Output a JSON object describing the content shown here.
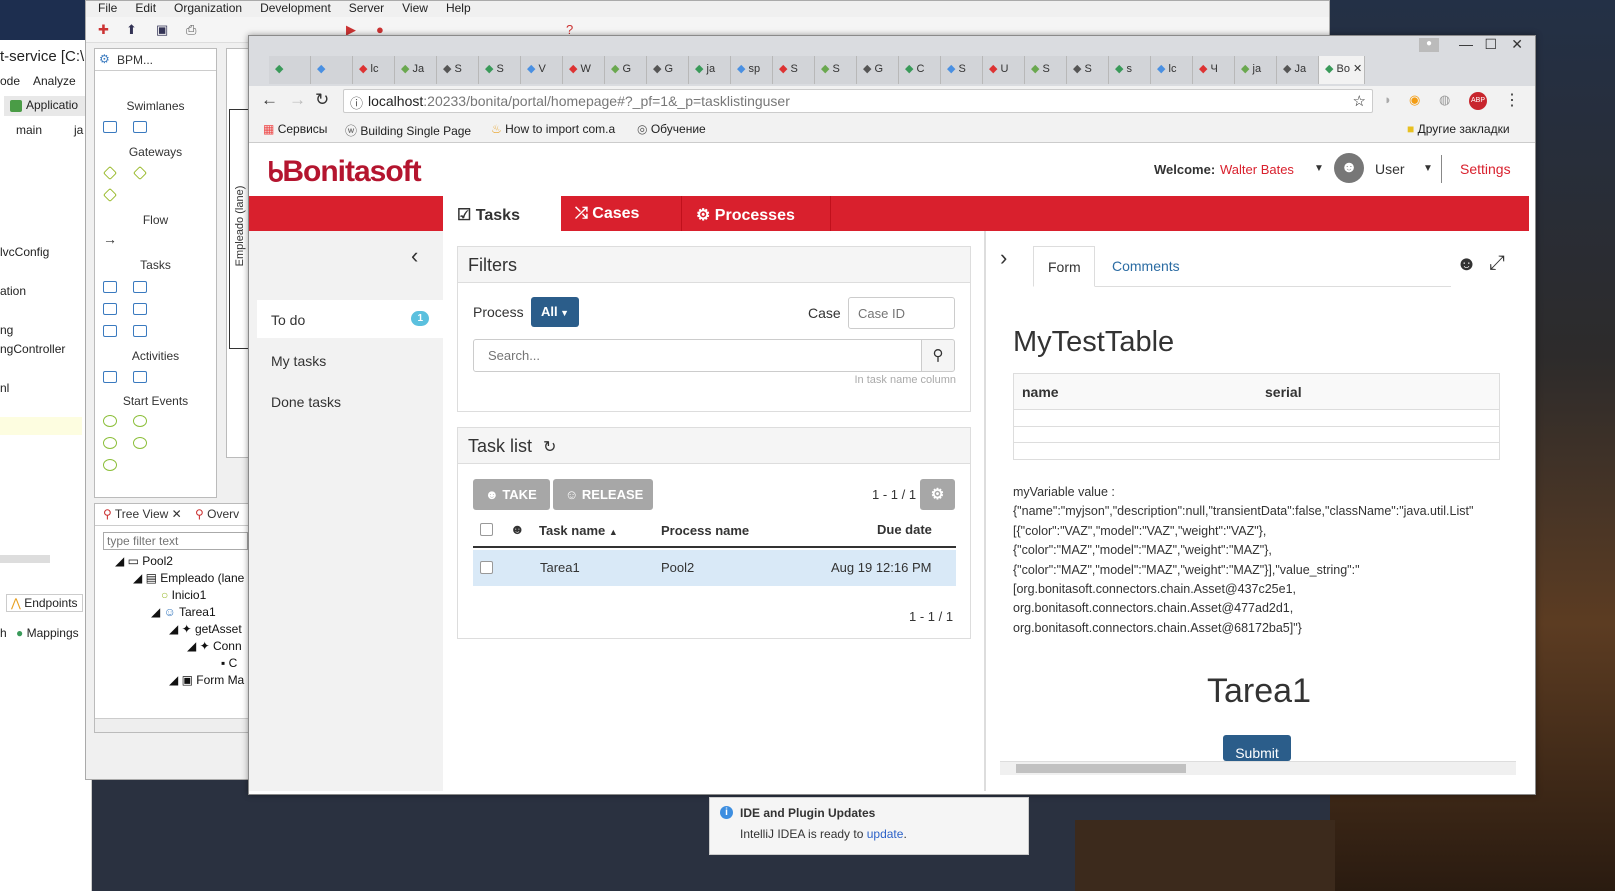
{
  "ide_left": {
    "title": "t-service [C:\\P",
    "menu": [
      "ode",
      "Analyze"
    ],
    "toolbar_label": "Applicatio",
    "crumbs": [
      "main",
      "ja"
    ],
    "items": [
      "lvcConfig",
      "ation",
      "ng",
      "ngController",
      "nl"
    ],
    "bottom_tabs": [
      "Endpoints",
      "Mappings"
    ],
    "bottom_prefix": "h"
  },
  "eclipse": {
    "menu": [
      "File",
      "Edit",
      "Organization",
      "Development",
      "Server",
      "View",
      "Help"
    ],
    "palette_tab": "BPM...",
    "palette_sections": [
      "Swimlanes",
      "Gateways",
      "Flow",
      "Tasks",
      "Activities",
      "Start Events"
    ],
    "lane_label": "Empleado (lane)",
    "tree_tabs": [
      "Tree View",
      "Overv"
    ],
    "tree_filter_placeholder": "type filter text",
    "tree_nodes": [
      "Pool2",
      "Empleado (lane",
      "Inicio1",
      "Tarea1",
      "getAsset",
      "Conn",
      "C",
      "Form Ma"
    ]
  },
  "chrome": {
    "tabs": [
      "",
      "",
      "lc",
      "Ja",
      "S",
      "S",
      "V",
      "W",
      "G",
      "G",
      "ja",
      "sp",
      "S",
      "S",
      "G",
      "C",
      "S",
      "U",
      "S",
      "S",
      "s",
      "lc",
      "Ч",
      "ja",
      "Ja",
      "Bo"
    ],
    "active_tab_label": "Bo",
    "url_host": "localhost",
    "url_rest": ":20233/bonita/portal/homepage#?_pf=1&_p=tasklistinguser",
    "bookmarks": [
      "Сервисы",
      "Building Single Page",
      "How to import com.a",
      "Обучение"
    ],
    "other_bookmarks": "Другие закладки"
  },
  "bonita": {
    "logo": "Bonitasoft",
    "welcome_label": "Welcome:",
    "user_name": "Walter Bates",
    "profile": "User",
    "settings": "Settings",
    "nav": [
      "Tasks",
      "Cases",
      "Processes"
    ],
    "sidebar": [
      {
        "label": "To do",
        "badge": "1"
      },
      {
        "label": "My tasks"
      },
      {
        "label": "Done tasks"
      }
    ],
    "filters": {
      "title": "Filters",
      "process_label": "Process",
      "process_value": "All",
      "case_label": "Case",
      "case_placeholder": "Case ID",
      "search_placeholder": "Search...",
      "search_hint": "In task name column"
    },
    "tasklist": {
      "title": "Task list",
      "take": "TAKE",
      "release": "RELEASE",
      "pager_top": "1 - 1 / 1",
      "pager_bottom": "1 - 1 / 1",
      "columns": [
        "Task name",
        "Process name",
        "Due date"
      ],
      "rows": [
        {
          "task": "Tarea1",
          "process": "Pool2",
          "due": "Aug 19 12:16 PM"
        }
      ]
    },
    "form": {
      "tabs": [
        "Form",
        "Comments"
      ],
      "table_title": "MyTestTable",
      "table_columns": [
        "name",
        "serial"
      ],
      "variable_lines": [
        "myVariable value :",
        "{\"name\":\"myjson\",\"description\":null,\"transientData\":false,\"className\":\"java.util.List\"",
        "[{\"color\":\"VAZ\",\"model\":\"VAZ\",\"weight\":\"VAZ\"},",
        "{\"color\":\"MAZ\",\"model\":\"MAZ\",\"weight\":\"MAZ\"},",
        "{\"color\":\"MAZ\",\"model\":\"MAZ\",\"weight\":\"MAZ\"}],\"value_string\":\"",
        "[org.bonitasoft.connectors.chain.Asset@437c25e1,",
        "org.bonitasoft.connectors.chain.Asset@477ad2d1,",
        "org.bonitasoft.connectors.chain.Asset@68172ba5]\"}"
      ],
      "task_title": "Tarea1",
      "submit": "Submit"
    }
  },
  "notification": {
    "title": "IDE and Plugin Updates",
    "text": "IntelliJ IDEA is ready to ",
    "link": "update",
    "suffix": "."
  },
  "colors": {
    "bonita_red": "#d9202d",
    "logo_red": "#b4152f",
    "primary": "#2b5d8a",
    "take_disabled": "#a7a7a7"
  }
}
